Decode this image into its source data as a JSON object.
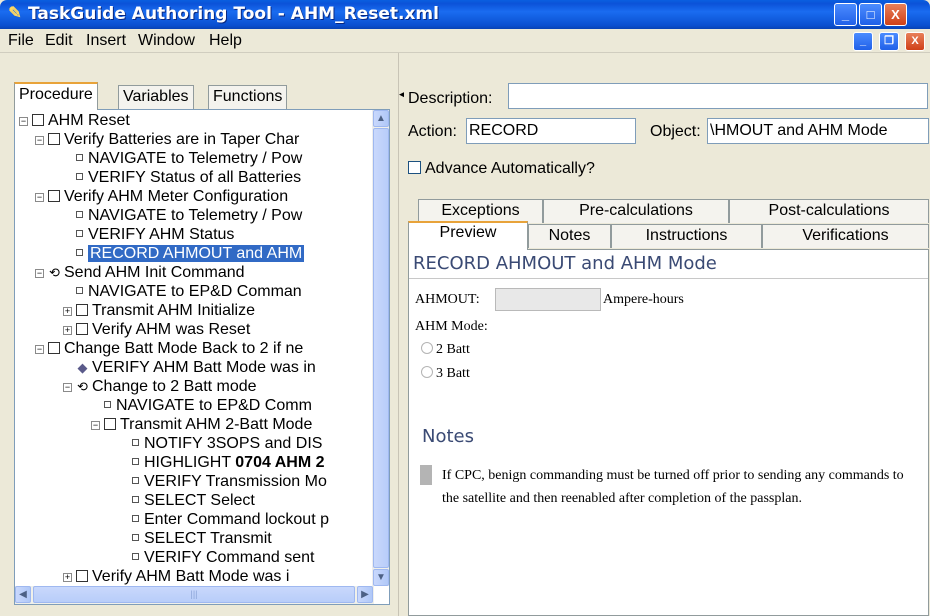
{
  "window": {
    "title": "TaskGuide Authoring Tool - AHM_Reset.xml",
    "icon": "feather-icon",
    "buttons": {
      "minimize": "_",
      "maximize": "□",
      "close": "X"
    }
  },
  "menu": {
    "items": [
      "File",
      "Edit",
      "Insert",
      "Window",
      "Help"
    ]
  },
  "left_tabs": [
    "Procedure",
    "Variables",
    "Functions"
  ],
  "tree": [
    {
      "label": "AHM Reset",
      "bold": "",
      "suffix": "",
      "expander": "⊟",
      "icon": "box"
    },
    {
      "label": "Verify Batteries are in Taper Char",
      "bold": "",
      "suffix": "",
      "expander": "⊟",
      "icon": "box"
    },
    {
      "label": "NAVIGATE to Telemetry / Pow",
      "bold": "",
      "suffix": "",
      "expander": "",
      "icon": "dot"
    },
    {
      "label": "VERIFY Status of all Batteries",
      "bold": "",
      "suffix": "",
      "expander": "",
      "icon": "dot"
    },
    {
      "label": "Verify AHM Meter Configuration",
      "bold": "",
      "suffix": "",
      "expander": "⊟",
      "icon": "box"
    },
    {
      "label": "NAVIGATE to Telemetry / Pow",
      "bold": "",
      "suffix": "",
      "expander": "",
      "icon": "dot"
    },
    {
      "label": "VERIFY AHM Status",
      "bold": "",
      "suffix": "",
      "expander": "",
      "icon": "dot"
    },
    {
      "label": "RECORD AHMOUT and AHM",
      "bold": "",
      "suffix": "",
      "expander": "",
      "icon": "dot",
      "selected": true
    },
    {
      "label": "Send AHM Init Command",
      "bold": "",
      "suffix": "",
      "expander": "⊟",
      "icon": "loop"
    },
    {
      "label": "NAVIGATE to EP&D Comman",
      "bold": "",
      "suffix": "",
      "expander": "",
      "icon": "dot"
    },
    {
      "label": "Transmit AHM Initialize",
      "bold": "",
      "suffix": "",
      "expander": "⊞",
      "icon": "box"
    },
    {
      "label": "Verify AHM was Reset",
      "bold": "",
      "suffix": "",
      "expander": "⊞",
      "icon": "box"
    },
    {
      "label": "Change Batt Mode Back to 2 if ne",
      "bold": "",
      "suffix": "",
      "expander": "⊟",
      "icon": "box"
    },
    {
      "label": "VERIFY AHM Batt Mode was in",
      "bold": "",
      "suffix": "",
      "expander": "",
      "icon": "diamond"
    },
    {
      "label": "Change to 2 Batt mode",
      "bold": "",
      "suffix": "",
      "expander": "⊟",
      "icon": "loop"
    },
    {
      "label": "NAVIGATE to EP&D Comm",
      "bold": "",
      "suffix": "",
      "expander": "",
      "icon": "dot"
    },
    {
      "label": "Transmit AHM 2-Batt Mode",
      "bold": "",
      "suffix": "",
      "expander": "⊟",
      "icon": "box"
    },
    {
      "label": "NOTIFY 3SOPS and DIS",
      "bold": "",
      "suffix": "",
      "expander": "",
      "icon": "dot"
    },
    {
      "label": "HIGHLIGHT ",
      "bold": "0704 AHM 2",
      "suffix": "",
      "expander": "",
      "icon": "dot"
    },
    {
      "label": "VERIFY Transmission Mo",
      "bold": "",
      "suffix": "",
      "expander": "",
      "icon": "dot"
    },
    {
      "label": "SELECT Select",
      "bold": "",
      "suffix": "",
      "expander": "",
      "icon": "dot"
    },
    {
      "label": "Enter Command lockout p",
      "bold": "",
      "suffix": "",
      "expander": "",
      "icon": "dot"
    },
    {
      "label": "SELECT Transmit",
      "bold": "",
      "suffix": "",
      "expander": "",
      "icon": "dot"
    },
    {
      "label": "VERIFY Command sent",
      "bold": "",
      "suffix": "",
      "expander": "",
      "icon": "dot"
    },
    {
      "label": "Verify AHM Batt Mode was i",
      "bold": "",
      "suffix": "",
      "expander": "⊞",
      "icon": "box"
    }
  ],
  "form": {
    "description_label": "Description:",
    "description_value": "",
    "action_label": "Action:",
    "action_value": "RECORD",
    "object_label": "Object:",
    "object_value": "\\HMOUT and AHM Mode",
    "advance_label": "Advance Automatically?"
  },
  "right_tabs_top": [
    "Exceptions",
    "Pre-calculations",
    "Post-calculations"
  ],
  "right_tabs_bottom": [
    "Preview",
    "Notes",
    "Instructions",
    "Verifications"
  ],
  "preview": {
    "heading": "RECORD AHMOUT and AHM Mode",
    "ahmout_label": "AHMOUT:",
    "ahmout_unit": "Ampere-hours",
    "mode_label": "AHM Mode:",
    "options": [
      "2 Batt",
      "3 Batt"
    ],
    "notes_heading": "Notes",
    "note_text": "If CPC, benign commanding must be turned off prior to sending any commands to the satellite and then reenabled after completion of the passplan."
  },
  "colors": {
    "titlebar": "#0b52d8",
    "selection": "#316ac5",
    "heading": "#3a4a74",
    "tab_accent": "#e8a33a"
  }
}
